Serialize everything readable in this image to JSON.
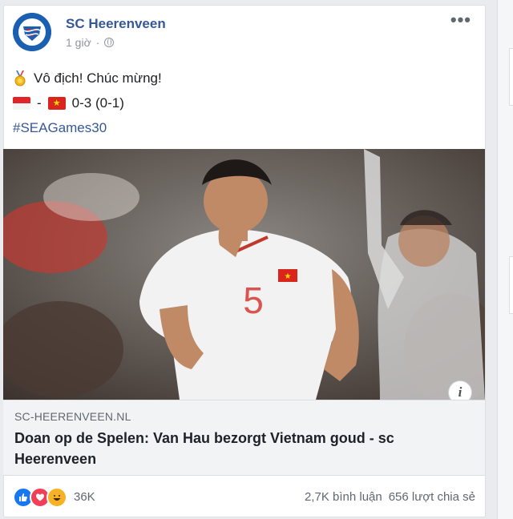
{
  "post": {
    "page_name": "SC Heerenveen",
    "time": "1 giờ",
    "separator": "·",
    "line1_text": "Vô địch! Chúc mừng!",
    "line2_dash": "-",
    "line2_score": "0-3 (0-1)",
    "hashtag": "#SEAGames30",
    "more_label": "•••"
  },
  "link": {
    "domain": "SC-HEERENVEEN.NL",
    "title": "Doan op de Spelen: Van Hau bezorgt Vietnam goud - sc Heerenveen",
    "info_label": "i",
    "jersey_number": "5"
  },
  "footer": {
    "reaction_count": "36K",
    "comments": "2,7K bình luận",
    "shares": "656 lượt chia sẻ"
  },
  "colors": {
    "link_blue": "#365899",
    "jersey": "#f2f2f2",
    "vn_red": "#da251d",
    "id_red": "#e0242c"
  },
  "icons": [
    "heerenveen-logo",
    "globe-icon",
    "more-icon",
    "medal-icon",
    "indonesia-flag-icon",
    "vietnam-flag-icon",
    "info-icon",
    "like-icon",
    "love-icon",
    "haha-icon"
  ]
}
